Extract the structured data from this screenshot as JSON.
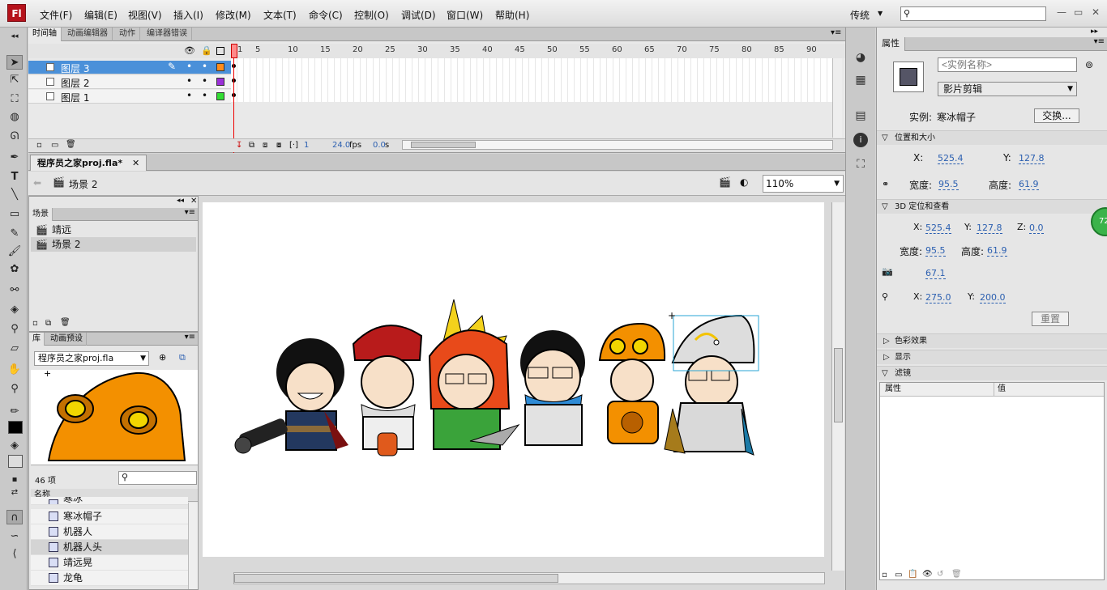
{
  "app": {
    "logo": "Fl"
  },
  "menu": [
    "文件(F)",
    "编辑(E)",
    "视图(V)",
    "插入(I)",
    "修改(M)",
    "文本(T)",
    "命令(C)",
    "控制(O)",
    "调试(D)",
    "窗口(W)",
    "帮助(H)"
  ],
  "workspace": "传统",
  "timeline": {
    "tabs": [
      "时间轴",
      "动画编辑器",
      "动作",
      "编译器错误"
    ],
    "frame_numbers": [
      "1",
      "5",
      "10",
      "15",
      "20",
      "25",
      "30",
      "35",
      "40",
      "45",
      "50",
      "55",
      "60",
      "65",
      "70",
      "75",
      "80",
      "85",
      "90"
    ],
    "layers": [
      {
        "name": "图层 3",
        "color": "#ff8c1a",
        "selected": true
      },
      {
        "name": "图层 2",
        "color": "#9b30d8",
        "selected": false
      },
      {
        "name": "图层 1",
        "color": "#33dd33",
        "selected": false
      }
    ],
    "status": {
      "frame": "1",
      "fps_value": "24.0",
      "fps_unit": "fps",
      "time_value": "0.0",
      "time_unit": "s"
    }
  },
  "document": {
    "tab": "程序员之家proj.fla*",
    "scene": "场景 2",
    "zoom": "110%"
  },
  "scene_panel": {
    "title": "场景",
    "scenes": [
      "靖远",
      "场景 2"
    ]
  },
  "library": {
    "tabs": [
      "库",
      "动画预设"
    ],
    "file": "程序员之家proj.fla",
    "count": "46 项",
    "name_header": "名称",
    "items": [
      "寒冰帽子",
      "机器人",
      "机器人头",
      "靖远晃",
      "龙龟"
    ],
    "partial_item": "寒冰"
  },
  "properties": {
    "tab": "属性",
    "instance_name_placeholder": "<实例名称>",
    "type": "影片剪辑",
    "instance_label": "实例:",
    "instance_of": "寒冰帽子",
    "swap_label": "交换...",
    "pos_section": "位置和大小",
    "x": "525.4",
    "y": "127.8",
    "width_label": "宽度:",
    "width": "95.5",
    "height_label": "高度:",
    "height": "61.9",
    "section_3d": "3D 定位和查看",
    "x3d": "525.4",
    "y3d": "127.8",
    "z3d": "0.0",
    "w3d": "95.5",
    "h3d": "61.9",
    "perspective": "67.1",
    "vx": "275.0",
    "vy": "200.0",
    "reset": "重置",
    "color_effect": "色彩效果",
    "display": "显示",
    "filters": "滤镜",
    "filter_cols": [
      "属性",
      "值"
    ]
  },
  "badge": "72"
}
